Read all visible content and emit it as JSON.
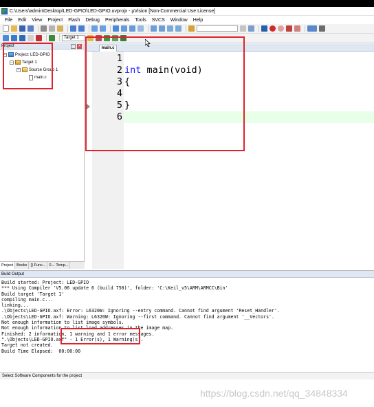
{
  "window": {
    "title": "C:\\Users\\admin\\Desktop\\LED-GPIO\\LED-GPIO.uvprojx - µVision  [Non-Commercial Use License]"
  },
  "menu": [
    "File",
    "Edit",
    "View",
    "Project",
    "Flash",
    "Debug",
    "Peripherals",
    "Tools",
    "SVCS",
    "Window",
    "Help"
  ],
  "toolbar": {
    "target_select": "Target 1"
  },
  "project_pane": {
    "title": "Project",
    "close_glyph": "x",
    "tree": {
      "project": "Project: LED-GPIO",
      "target": "Target 1",
      "group": "Source Group 1",
      "file": "main.c"
    },
    "tabs": [
      "Project",
      "Books",
      "{} Func...",
      "0→ Temp..."
    ]
  },
  "editor": {
    "tab": "main.c",
    "lines": [
      {
        "num": "1",
        "keyword": "",
        "text": ""
      },
      {
        "num": "2",
        "keyword": "int",
        "text": " main(void)"
      },
      {
        "num": "3",
        "keyword": "",
        "text": "{"
      },
      {
        "num": "4",
        "keyword": "",
        "text": ""
      },
      {
        "num": "5",
        "keyword": "",
        "text": "}"
      },
      {
        "num": "6",
        "keyword": "",
        "text": ""
      }
    ]
  },
  "build_output": {
    "title": "Build Output",
    "lines": [
      "Build started: Project: LED-GPIO",
      "*** Using Compiler 'V5.06 update 6 (build 750)', folder: 'C:\\Keil_v5\\ARM\\ARMCC\\Bin'",
      "Build target 'Target 1'",
      "compiling main.c...",
      "linking...",
      ".\\Objects\\LED-GPIO.axf: Error: L6320W: Ignoring --entry command. Cannot find argument 'Reset_Handler'.",
      ".\\Objects\\LED-GPIO.axf: Warning: L6320W: Ignoring --first command. Cannot find argument '__Vectors'.",
      "Not enough information to list image symbols.",
      "Not enough information to list load addresses in the image map.",
      "Finished: 2 information, 1 warning and 1 error messages.",
      "\".\\Objects\\LED-GPIO.axf\" - 1 Error(s), 1 Warning(s).",
      "Target not created.",
      "Build Time Elapsed:  00:00:00"
    ]
  },
  "status_bar": "Select Software Components for the project",
  "watermark": "https://blog.csdn.net/qq_34848334",
  "colors": {
    "annotation": "#e0202c",
    "keyword": "#1c1cff",
    "current_line": "#e8ffe8"
  }
}
